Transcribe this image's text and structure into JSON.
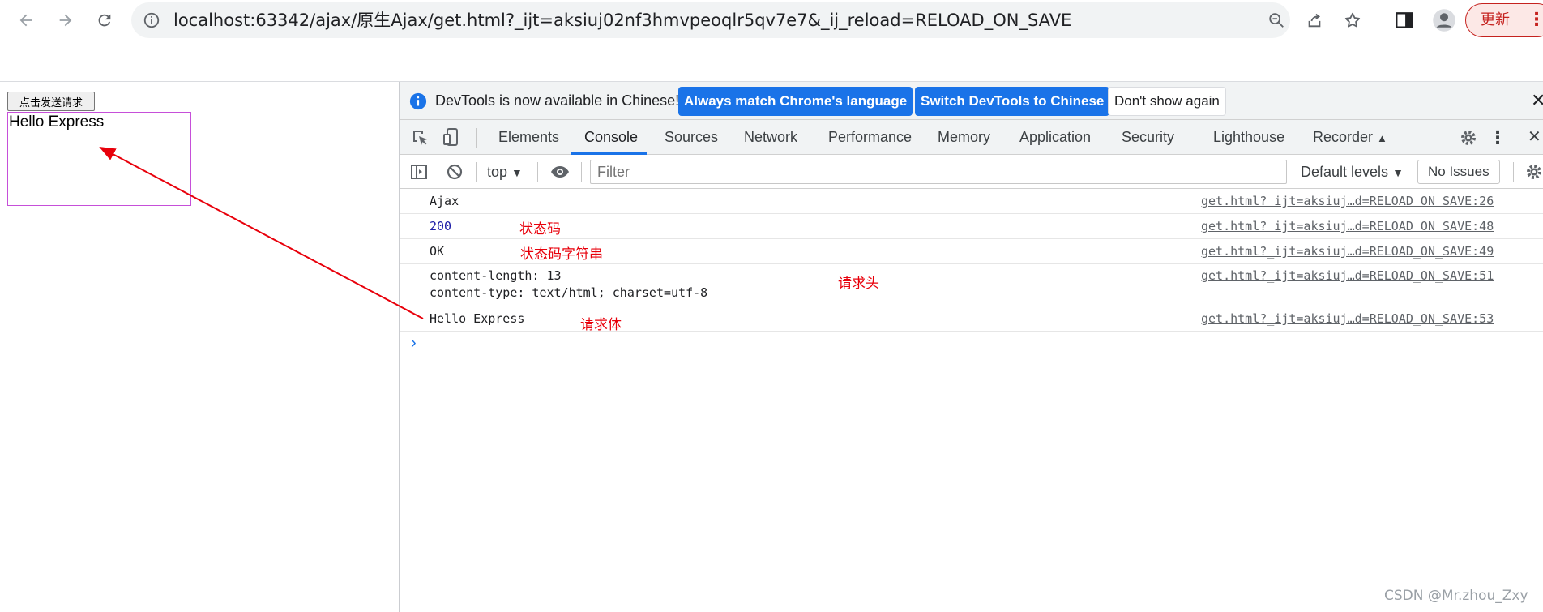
{
  "browser": {
    "url": "localhost:63342/ajax/原生Ajax/get.html?_ijt=aksiuj02nf3hmvpeoqlr5qv7e7&_ij_reload=RELOAD_ON_SAVE",
    "update_label": "更新",
    "icons": [
      "back-icon",
      "forward-icon",
      "reload-icon",
      "site-info-icon",
      "zoom-icon",
      "share-icon",
      "bookmark-star-icon",
      "side-panel-icon",
      "profile-icon",
      "menu-icon"
    ]
  },
  "page": {
    "button_label": "点击发送请求",
    "result_text": "Hello Express"
  },
  "devtools": {
    "infobar": {
      "message": "DevTools is now available in Chinese!",
      "btn_match": "Always match Chrome's language",
      "btn_switch": "Switch DevTools to Chinese",
      "btn_dismiss": "Don't show again"
    },
    "tabs": [
      "Elements",
      "Console",
      "Sources",
      "Network",
      "Performance",
      "Memory",
      "Application",
      "Security",
      "Lighthouse",
      "Recorder"
    ],
    "active_tab": "Console",
    "console_bar": {
      "context": "top",
      "filter_placeholder": "Filter",
      "levels": "Default levels",
      "issues": "No Issues"
    },
    "console_rows": [
      {
        "lines": [
          "Ajax"
        ],
        "source": "get.html?_ijt=aksiuj…d=RELOAD_ON_SAVE:26",
        "annotation": ""
      },
      {
        "lines": [
          "200"
        ],
        "source": "get.html?_ijt=aksiuj…d=RELOAD_ON_SAVE:48",
        "annotation": "状态码"
      },
      {
        "lines": [
          "OK"
        ],
        "source": "get.html?_ijt=aksiuj…d=RELOAD_ON_SAVE:49",
        "annotation": "状态码字符串"
      },
      {
        "lines": [
          "content-length: 13",
          "content-type: text/html; charset=utf-8"
        ],
        "source": "get.html?_ijt=aksiuj…d=RELOAD_ON_SAVE:51",
        "annotation": "请求头"
      },
      {
        "lines": [
          "Hello Express"
        ],
        "source": "get.html?_ijt=aksiuj…d=RELOAD_ON_SAVE:53",
        "annotation": "请求体"
      }
    ]
  },
  "colors": {
    "accent": "#1a73e8",
    "annotation": "#e8000b",
    "result_border": "#c64fd9"
  },
  "watermark": "CSDN @Mr.zhou_Zxy"
}
